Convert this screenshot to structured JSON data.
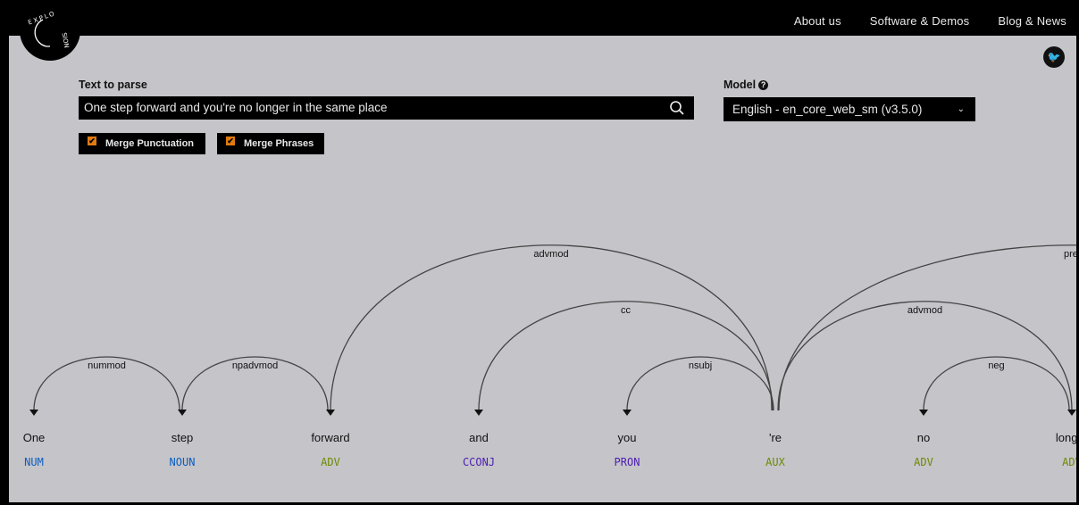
{
  "logo": {
    "text": "EXPLOSION"
  },
  "nav": [
    {
      "label": "About us"
    },
    {
      "label": "Software & Demos"
    },
    {
      "label": "Blog & News"
    }
  ],
  "form": {
    "text_label": "Text to parse",
    "text_value": "One step forward and you're no longer in the same place",
    "model_label": "Model",
    "model_value": "English - en_core_web_sm (v3.5.0)",
    "merge_punct": "Merge Punctuation",
    "merge_phrases": "Merge Phrases"
  },
  "colors": {
    "bg": "#c5c4c9",
    "arc": "#444444",
    "NUM": "#0a5ec2",
    "NOUN": "#0a5ec2",
    "ADV": "#6b8a00",
    "AUX": "#6b8a00",
    "CCONJ": "#4d1eb0",
    "PRON": "#4d1eb0"
  },
  "parse": {
    "words": [
      {
        "text": "One",
        "tag": "NUM"
      },
      {
        "text": "step",
        "tag": "NOUN"
      },
      {
        "text": "forward",
        "tag": "ADV"
      },
      {
        "text": "and",
        "tag": "CCONJ"
      },
      {
        "text": "you",
        "tag": "PRON"
      },
      {
        "text": "'re",
        "tag": "AUX"
      },
      {
        "text": "no",
        "tag": "ADV"
      },
      {
        "text": "longer",
        "tag": "ADV"
      }
    ],
    "arcs": [
      {
        "label": "nummod",
        "head": 1,
        "dep": 0,
        "level": 1
      },
      {
        "label": "npadvmod",
        "head": 2,
        "dep": 1,
        "level": 1
      },
      {
        "label": "advmod",
        "head": 5,
        "dep": 2,
        "level": 3
      },
      {
        "label": "cc",
        "head": 5,
        "dep": 3,
        "level": 2
      },
      {
        "label": "nsubj",
        "head": 5,
        "dep": 4,
        "level": 1
      },
      {
        "label": "neg",
        "head": 7,
        "dep": 6,
        "level": 1
      },
      {
        "label": "advmod",
        "head": 5,
        "dep": 7,
        "level": 2
      },
      {
        "label": "prep",
        "head": 5,
        "dep": 9,
        "level": 3
      }
    ]
  }
}
